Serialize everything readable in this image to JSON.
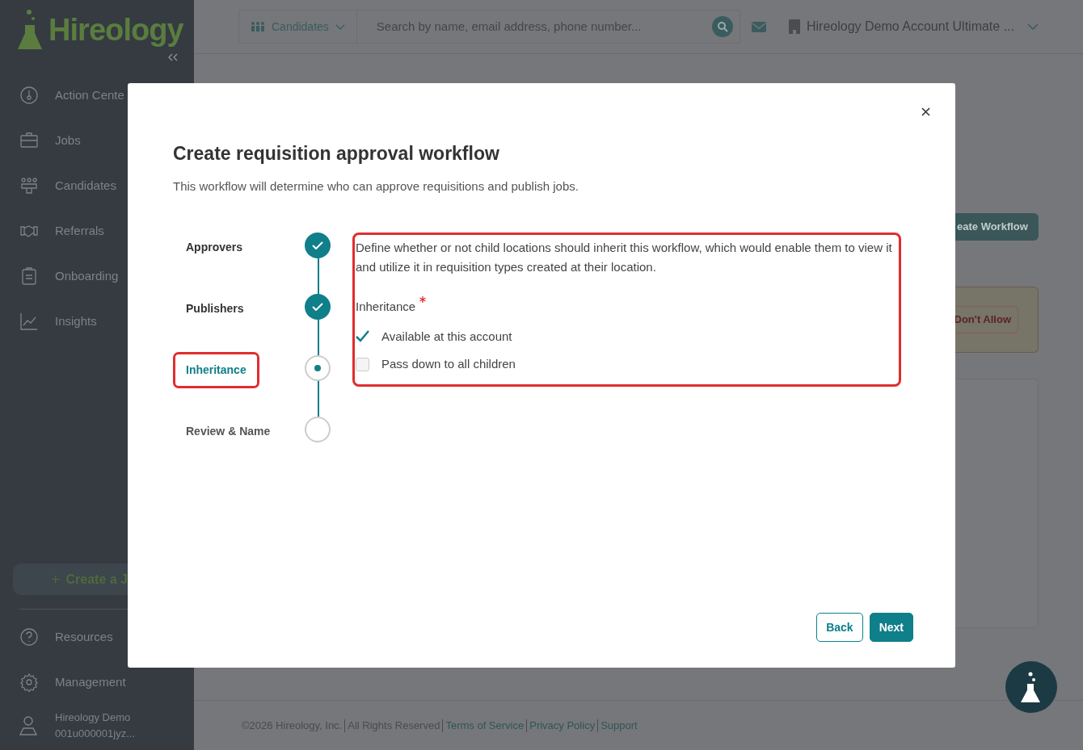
{
  "sidebar": {
    "logo": "Hireology",
    "items": [
      {
        "label": "Action Cente"
      },
      {
        "label": "Jobs"
      },
      {
        "label": "Candidates"
      },
      {
        "label": "Referrals"
      },
      {
        "label": "Onboarding"
      },
      {
        "label": "Insights"
      }
    ],
    "create_button": "Create a J",
    "bottom_items": [
      {
        "label": "Resources"
      },
      {
        "label": "Management"
      }
    ],
    "user": {
      "name": "Hireology Demo",
      "account": "001u000001jyz..."
    }
  },
  "header": {
    "scope": "Candidates",
    "search": {
      "placeholder": "Search by name, email address, phone number..."
    },
    "account": "Hireology Demo Account Ultimate ..."
  },
  "background": {
    "create_button": "eate Workflow",
    "warning_button": "Don't Allow"
  },
  "footer": {
    "copyright": "©2026 Hireology, Inc.",
    "rights": "All Rights Reserved",
    "links": [
      "Terms of Service",
      "Privacy Policy",
      "Support"
    ]
  },
  "modal": {
    "title": "Create requisition approval workflow",
    "subtitle": "This workflow will determine who can approve requisitions and publish jobs.",
    "steps": [
      {
        "label": "Approvers",
        "completed": true,
        "selected": false
      },
      {
        "label": "Publishers",
        "completed": true,
        "selected": false
      },
      {
        "label": "Inheritance",
        "completed": false,
        "selected": true
      },
      {
        "label": "Review & Name",
        "completed": false,
        "selected": false
      }
    ],
    "description": "Define whether or not child locations should inherit this workflow, which would enable them to view it and utilize it in requisition types created at their location.",
    "field_label": "Inheritance",
    "required": true,
    "options": [
      {
        "label": "Available at this account",
        "checked": true
      },
      {
        "label": "Pass down to all children",
        "checked": false
      }
    ],
    "buttons": [
      {
        "kind": "secondary",
        "label": "Back"
      },
      {
        "kind": "primary",
        "label": "Next"
      }
    ]
  }
}
